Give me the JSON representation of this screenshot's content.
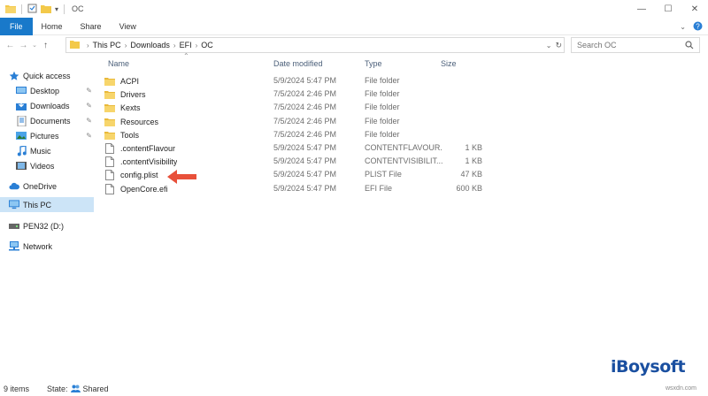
{
  "window": {
    "title": "OC"
  },
  "ribbon": {
    "tabs": [
      "File",
      "Home",
      "Share",
      "View"
    ]
  },
  "address": {
    "crumbs": [
      "This PC",
      "Downloads",
      "EFI",
      "OC"
    ]
  },
  "search": {
    "placeholder": "Search OC"
  },
  "sidebar": {
    "items": [
      {
        "label": "Quick access",
        "icon": "star-icon",
        "pinned": false,
        "selected": false
      },
      {
        "label": "Desktop",
        "icon": "desktop-folder-icon",
        "pinned": true,
        "selected": false
      },
      {
        "label": "Downloads",
        "icon": "downloads-folder-icon",
        "pinned": true,
        "selected": false
      },
      {
        "label": "Documents",
        "icon": "documents-folder-icon",
        "pinned": true,
        "selected": false
      },
      {
        "label": "Pictures",
        "icon": "pictures-folder-icon",
        "pinned": true,
        "selected": false
      },
      {
        "label": "Music",
        "icon": "music-icon",
        "pinned": false,
        "selected": false
      },
      {
        "label": "Videos",
        "icon": "videos-icon",
        "pinned": false,
        "selected": false
      },
      {
        "label": "OneDrive",
        "icon": "cloud-icon",
        "pinned": false,
        "selected": false
      },
      {
        "label": "This PC",
        "icon": "computer-icon",
        "pinned": false,
        "selected": true
      },
      {
        "label": "PEN32 (D:)",
        "icon": "drive-icon",
        "pinned": false,
        "selected": false
      },
      {
        "label": "Network",
        "icon": "network-icon",
        "pinned": false,
        "selected": false
      }
    ]
  },
  "columns": {
    "name": "Name",
    "date": "Date modified",
    "type": "Type",
    "size": "Size"
  },
  "files": [
    {
      "name": "ACPI",
      "date": "5/9/2024 5:47 PM",
      "type": "File folder",
      "size": "",
      "kind": "folder"
    },
    {
      "name": "Drivers",
      "date": "7/5/2024 2:46 PM",
      "type": "File folder",
      "size": "",
      "kind": "folder"
    },
    {
      "name": "Kexts",
      "date": "7/5/2024 2:46 PM",
      "type": "File folder",
      "size": "",
      "kind": "folder"
    },
    {
      "name": "Resources",
      "date": "7/5/2024 2:46 PM",
      "type": "File folder",
      "size": "",
      "kind": "folder"
    },
    {
      "name": "Tools",
      "date": "7/5/2024 2:46 PM",
      "type": "File folder",
      "size": "",
      "kind": "folder"
    },
    {
      "name": ".contentFlavour",
      "date": "5/9/2024 5:47 PM",
      "type": "CONTENTFLAVOUR...",
      "size": "1 KB",
      "kind": "file"
    },
    {
      "name": ".contentVisibility",
      "date": "5/9/2024 5:47 PM",
      "type": "CONTENTVISIBILIT...",
      "size": "1 KB",
      "kind": "file"
    },
    {
      "name": "config.plist",
      "date": "5/9/2024 5:47 PM",
      "type": "PLIST File",
      "size": "47 KB",
      "kind": "file"
    },
    {
      "name": "OpenCore.efi",
      "date": "5/9/2024 5:47 PM",
      "type": "EFI File",
      "size": "600 KB",
      "kind": "file"
    }
  ],
  "status": {
    "items": "9 items",
    "state": "State:",
    "shared": "Shared"
  },
  "watermark": {
    "brand": "iBoysoft",
    "site": "wsxdn.com"
  },
  "colors": {
    "accent": "#1979ca",
    "folder": "#f3c94a",
    "selected": "#cce4f7",
    "arrow": "#e8503a"
  }
}
